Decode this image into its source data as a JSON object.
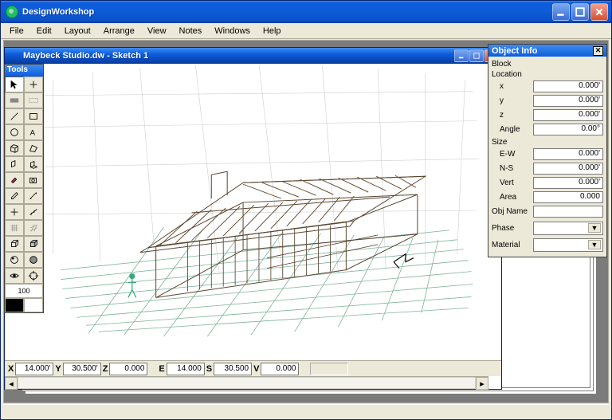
{
  "app": {
    "title": "DesignWorkshop"
  },
  "menus": [
    "File",
    "Edit",
    "Layout",
    "Arrange",
    "View",
    "Notes",
    "Windows",
    "Help"
  ],
  "doc": {
    "title": "Maybeck Studio.dw - Sketch 1"
  },
  "tools_palette": {
    "title": "Tools",
    "zoom_value": "100"
  },
  "coordbar": {
    "X": "14.000'",
    "Y": "30.500'",
    "Z": "0.000",
    "E": "14.000",
    "S": "30.500",
    "V": "0.000",
    "extra": ""
  },
  "objinfo": {
    "title": "Object Info",
    "type_label": "Block",
    "section_location": "Location",
    "x": "0.000'",
    "y": "0.000'",
    "z": "0.000'",
    "angle": "0.00°",
    "section_size": "Size",
    "ew": "0.000'",
    "ns": "0.000'",
    "vert": "0.000'",
    "area": "0.000",
    "objname_label": "Obj Name",
    "objname": "",
    "phase_label": "Phase",
    "phase": "",
    "material_label": "Material",
    "material": "",
    "labels": {
      "x": "x",
      "y": "y",
      "z": "z",
      "angle": "Angle",
      "ew": "E-W",
      "ns": "N-S",
      "vert": "Vert",
      "area": "Area"
    }
  }
}
